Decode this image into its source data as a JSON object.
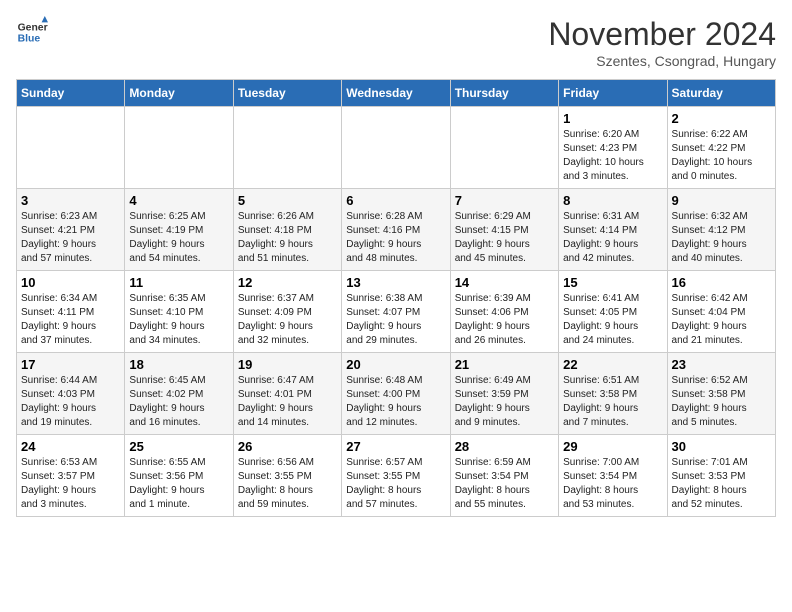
{
  "header": {
    "logo_line1": "General",
    "logo_line2": "Blue",
    "month": "November 2024",
    "location": "Szentes, Csongrad, Hungary"
  },
  "weekdays": [
    "Sunday",
    "Monday",
    "Tuesday",
    "Wednesday",
    "Thursday",
    "Friday",
    "Saturday"
  ],
  "weeks": [
    [
      {
        "day": "",
        "info": ""
      },
      {
        "day": "",
        "info": ""
      },
      {
        "day": "",
        "info": ""
      },
      {
        "day": "",
        "info": ""
      },
      {
        "day": "",
        "info": ""
      },
      {
        "day": "1",
        "info": "Sunrise: 6:20 AM\nSunset: 4:23 PM\nDaylight: 10 hours\nand 3 minutes."
      },
      {
        "day": "2",
        "info": "Sunrise: 6:22 AM\nSunset: 4:22 PM\nDaylight: 10 hours\nand 0 minutes."
      }
    ],
    [
      {
        "day": "3",
        "info": "Sunrise: 6:23 AM\nSunset: 4:21 PM\nDaylight: 9 hours\nand 57 minutes."
      },
      {
        "day": "4",
        "info": "Sunrise: 6:25 AM\nSunset: 4:19 PM\nDaylight: 9 hours\nand 54 minutes."
      },
      {
        "day": "5",
        "info": "Sunrise: 6:26 AM\nSunset: 4:18 PM\nDaylight: 9 hours\nand 51 minutes."
      },
      {
        "day": "6",
        "info": "Sunrise: 6:28 AM\nSunset: 4:16 PM\nDaylight: 9 hours\nand 48 minutes."
      },
      {
        "day": "7",
        "info": "Sunrise: 6:29 AM\nSunset: 4:15 PM\nDaylight: 9 hours\nand 45 minutes."
      },
      {
        "day": "8",
        "info": "Sunrise: 6:31 AM\nSunset: 4:14 PM\nDaylight: 9 hours\nand 42 minutes."
      },
      {
        "day": "9",
        "info": "Sunrise: 6:32 AM\nSunset: 4:12 PM\nDaylight: 9 hours\nand 40 minutes."
      }
    ],
    [
      {
        "day": "10",
        "info": "Sunrise: 6:34 AM\nSunset: 4:11 PM\nDaylight: 9 hours\nand 37 minutes."
      },
      {
        "day": "11",
        "info": "Sunrise: 6:35 AM\nSunset: 4:10 PM\nDaylight: 9 hours\nand 34 minutes."
      },
      {
        "day": "12",
        "info": "Sunrise: 6:37 AM\nSunset: 4:09 PM\nDaylight: 9 hours\nand 32 minutes."
      },
      {
        "day": "13",
        "info": "Sunrise: 6:38 AM\nSunset: 4:07 PM\nDaylight: 9 hours\nand 29 minutes."
      },
      {
        "day": "14",
        "info": "Sunrise: 6:39 AM\nSunset: 4:06 PM\nDaylight: 9 hours\nand 26 minutes."
      },
      {
        "day": "15",
        "info": "Sunrise: 6:41 AM\nSunset: 4:05 PM\nDaylight: 9 hours\nand 24 minutes."
      },
      {
        "day": "16",
        "info": "Sunrise: 6:42 AM\nSunset: 4:04 PM\nDaylight: 9 hours\nand 21 minutes."
      }
    ],
    [
      {
        "day": "17",
        "info": "Sunrise: 6:44 AM\nSunset: 4:03 PM\nDaylight: 9 hours\nand 19 minutes."
      },
      {
        "day": "18",
        "info": "Sunrise: 6:45 AM\nSunset: 4:02 PM\nDaylight: 9 hours\nand 16 minutes."
      },
      {
        "day": "19",
        "info": "Sunrise: 6:47 AM\nSunset: 4:01 PM\nDaylight: 9 hours\nand 14 minutes."
      },
      {
        "day": "20",
        "info": "Sunrise: 6:48 AM\nSunset: 4:00 PM\nDaylight: 9 hours\nand 12 minutes."
      },
      {
        "day": "21",
        "info": "Sunrise: 6:49 AM\nSunset: 3:59 PM\nDaylight: 9 hours\nand 9 minutes."
      },
      {
        "day": "22",
        "info": "Sunrise: 6:51 AM\nSunset: 3:58 PM\nDaylight: 9 hours\nand 7 minutes."
      },
      {
        "day": "23",
        "info": "Sunrise: 6:52 AM\nSunset: 3:58 PM\nDaylight: 9 hours\nand 5 minutes."
      }
    ],
    [
      {
        "day": "24",
        "info": "Sunrise: 6:53 AM\nSunset: 3:57 PM\nDaylight: 9 hours\nand 3 minutes."
      },
      {
        "day": "25",
        "info": "Sunrise: 6:55 AM\nSunset: 3:56 PM\nDaylight: 9 hours\nand 1 minute."
      },
      {
        "day": "26",
        "info": "Sunrise: 6:56 AM\nSunset: 3:55 PM\nDaylight: 8 hours\nand 59 minutes."
      },
      {
        "day": "27",
        "info": "Sunrise: 6:57 AM\nSunset: 3:55 PM\nDaylight: 8 hours\nand 57 minutes."
      },
      {
        "day": "28",
        "info": "Sunrise: 6:59 AM\nSunset: 3:54 PM\nDaylight: 8 hours\nand 55 minutes."
      },
      {
        "day": "29",
        "info": "Sunrise: 7:00 AM\nSunset: 3:54 PM\nDaylight: 8 hours\nand 53 minutes."
      },
      {
        "day": "30",
        "info": "Sunrise: 7:01 AM\nSunset: 3:53 PM\nDaylight: 8 hours\nand 52 minutes."
      }
    ]
  ]
}
